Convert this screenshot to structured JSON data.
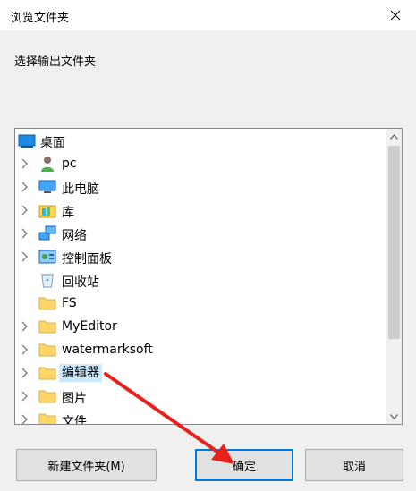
{
  "dialog": {
    "title": "浏览文件夹",
    "prompt": "选择输出文件夹"
  },
  "tree": {
    "root": {
      "label": "桌面",
      "icon": "desktop-icon"
    },
    "items": [
      {
        "label": "pc",
        "icon": "user-icon",
        "expandable": true
      },
      {
        "label": "此电脑",
        "icon": "computer-icon",
        "expandable": true
      },
      {
        "label": "库",
        "icon": "library-icon",
        "expandable": true
      },
      {
        "label": "网络",
        "icon": "network-icon",
        "expandable": true
      },
      {
        "label": "控制面板",
        "icon": "control-panel-icon",
        "expandable": true
      },
      {
        "label": "回收站",
        "icon": "recycle-bin-icon",
        "expandable": false
      },
      {
        "label": "FS",
        "icon": "folder-icon",
        "expandable": false
      },
      {
        "label": "MyEditor",
        "icon": "folder-icon",
        "expandable": true
      },
      {
        "label": "watermarksoft",
        "icon": "folder-icon",
        "expandable": true
      },
      {
        "label": "编辑器",
        "icon": "folder-icon",
        "expandable": true,
        "selected": true
      },
      {
        "label": "图片",
        "icon": "folder-icon",
        "expandable": true
      },
      {
        "label": "文件",
        "icon": "folder-icon",
        "expandable": true
      }
    ]
  },
  "buttons": {
    "new_folder": "新建文件夹(M)",
    "ok": "确定",
    "cancel": "取消"
  },
  "colors": {
    "selection": "#cce8ff",
    "default_button_border": "#0078d7",
    "annotation_arrow": "#e8221b"
  }
}
